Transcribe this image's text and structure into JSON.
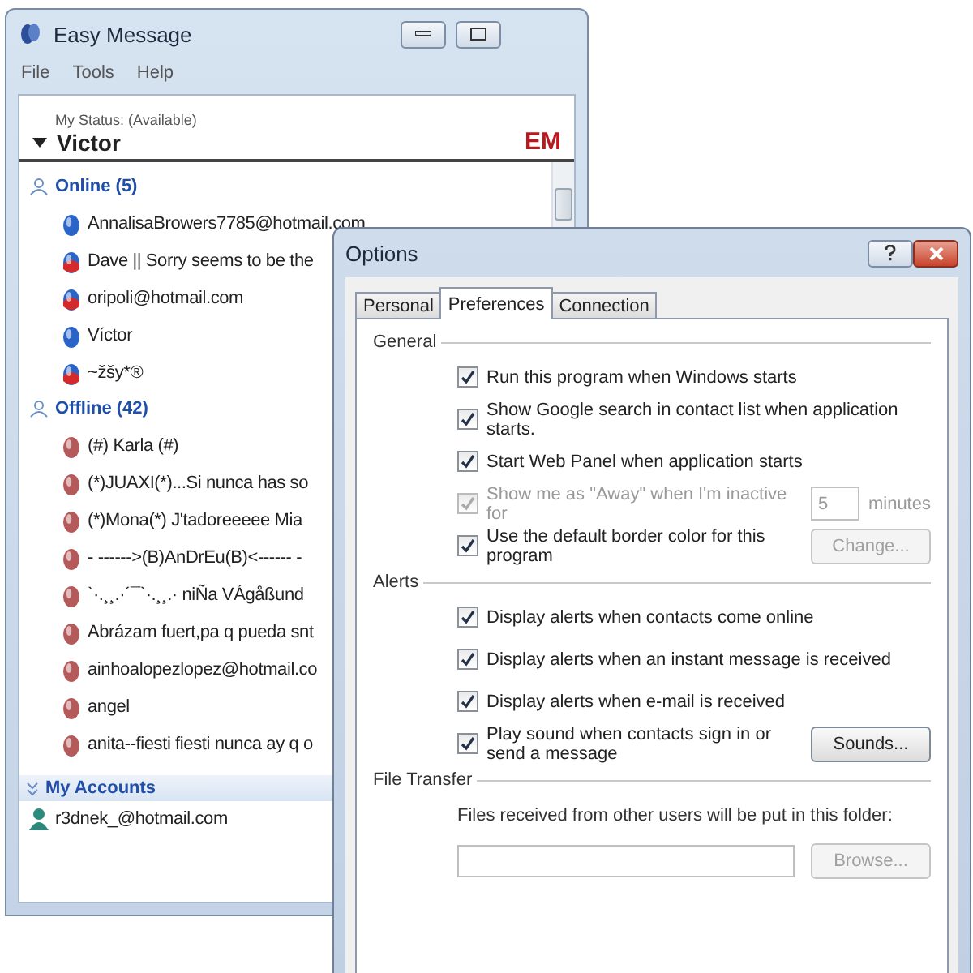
{
  "main_window": {
    "title": "Easy Message",
    "menu": [
      "File",
      "Tools",
      "Help"
    ],
    "status_label": "My Status: (Available)",
    "user_name": "Victor",
    "logo": "EM",
    "groups": [
      {
        "label": "Online (5)",
        "expanded": true,
        "contacts": [
          {
            "name": "AnnalisaBrowers7785@hotmail.com",
            "kind": "online"
          },
          {
            "name": "Dave || Sorry seems to be the",
            "kind": "busy"
          },
          {
            "name": "oripoli@hotmail.com",
            "kind": "busy"
          },
          {
            "name": "Víctor",
            "kind": "online"
          },
          {
            "name": "~žšy*®",
            "kind": "busy"
          }
        ]
      },
      {
        "label": "Offline (42)",
        "expanded": true,
        "contacts": [
          {
            "name": "(#) Karla (#)",
            "kind": "offline"
          },
          {
            "name": "(*)JUAXI(*)...Si nunca has so",
            "kind": "offline"
          },
          {
            "name": "(*)Mona(*) J'tadoreeeee Mia",
            "kind": "offline"
          },
          {
            "name": "- ------>(B)AnDrEu(B)<------ -",
            "kind": "offline"
          },
          {
            "name": "`·.¸¸.·´¯`·.¸¸.· niÑa VÁgåßund",
            "kind": "offline"
          },
          {
            "name": "Abrázam fuert,pa q pueda snt",
            "kind": "offline"
          },
          {
            "name": "ainhoalopezlopez@hotmail.co",
            "kind": "offline"
          },
          {
            "name": "angel",
            "kind": "offline"
          },
          {
            "name": "anita--fiesti fiesti nunca ay q o",
            "kind": "offline"
          }
        ]
      }
    ],
    "accounts_label": "My Accounts",
    "accounts": [
      "r3dnek_@hotmail.com"
    ]
  },
  "options_window": {
    "title": "Options",
    "tabs": [
      {
        "label": "Personal",
        "selected": false
      },
      {
        "label": "Preferences",
        "selected": true
      },
      {
        "label": "Connection",
        "selected": false
      }
    ],
    "sections": [
      {
        "title": "General",
        "items": [
          {
            "kind": "check",
            "label": "Run this program when Windows starts",
            "checked": true,
            "disabled": false
          },
          {
            "kind": "check",
            "label": "Show Google search in contact list when application starts.",
            "checked": true,
            "disabled": false
          },
          {
            "kind": "check",
            "label": "Start Web Panel when application starts",
            "checked": true,
            "disabled": false
          },
          {
            "kind": "check_field",
            "label": "Show me as \"Away\" when I'm inactive for",
            "checked": true,
            "disabled": true,
            "value": "5",
            "unit": "minutes"
          },
          {
            "kind": "check_button",
            "label": "Use the default border color for this program",
            "checked": true,
            "disabled": false,
            "button": "Change...",
            "button_disabled": true
          }
        ]
      },
      {
        "title": "Alerts",
        "items": [
          {
            "kind": "check",
            "label": "Display alerts when contacts come online",
            "checked": true,
            "disabled": false
          },
          {
            "kind": "check",
            "label": "Display alerts when an instant message is received",
            "checked": true,
            "disabled": false
          },
          {
            "kind": "check",
            "label": "Display alerts when e-mail is received",
            "checked": true,
            "disabled": false
          },
          {
            "kind": "check_button",
            "label": "Play sound when contacts sign in or send a message",
            "checked": true,
            "disabled": false,
            "button": "Sounds...",
            "button_disabled": false
          }
        ]
      },
      {
        "title": "File Transfer",
        "items": [
          {
            "kind": "note",
            "label": "Files received from other users will be put in this folder:"
          },
          {
            "kind": "path",
            "button": "Browse...",
            "button_disabled": true
          }
        ]
      }
    ]
  }
}
